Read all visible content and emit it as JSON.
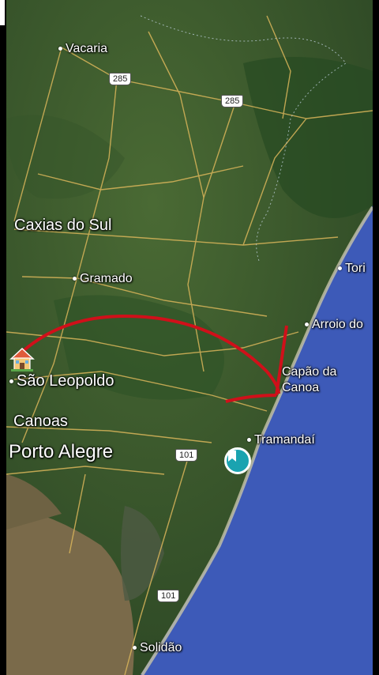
{
  "places": {
    "vacaria": "Vacaria",
    "caxias": "Caxias do Sul",
    "gramado": "Gramado",
    "sao_leopoldo": "São Leopoldo",
    "canoas": "Canoas",
    "porto_alegre": "Porto Alegre",
    "torres": "Tori",
    "arroio": "Arroio do",
    "capao_line1": "Capão da",
    "capao_line2": "Canoa",
    "tramandai": "Tramandaí",
    "solidao": "Solidão"
  },
  "routes": {
    "r285_a": "285",
    "r285_b": "285",
    "r101_a": "101",
    "r101_b": "101"
  },
  "icons": {
    "origin": "house-icon",
    "destination": "bookmark-pin-icon"
  },
  "colors": {
    "ocean": "#3d5ab8",
    "land": "#3d5a2e",
    "arrow": "#d0101a",
    "pin": "#1aa3b0"
  }
}
